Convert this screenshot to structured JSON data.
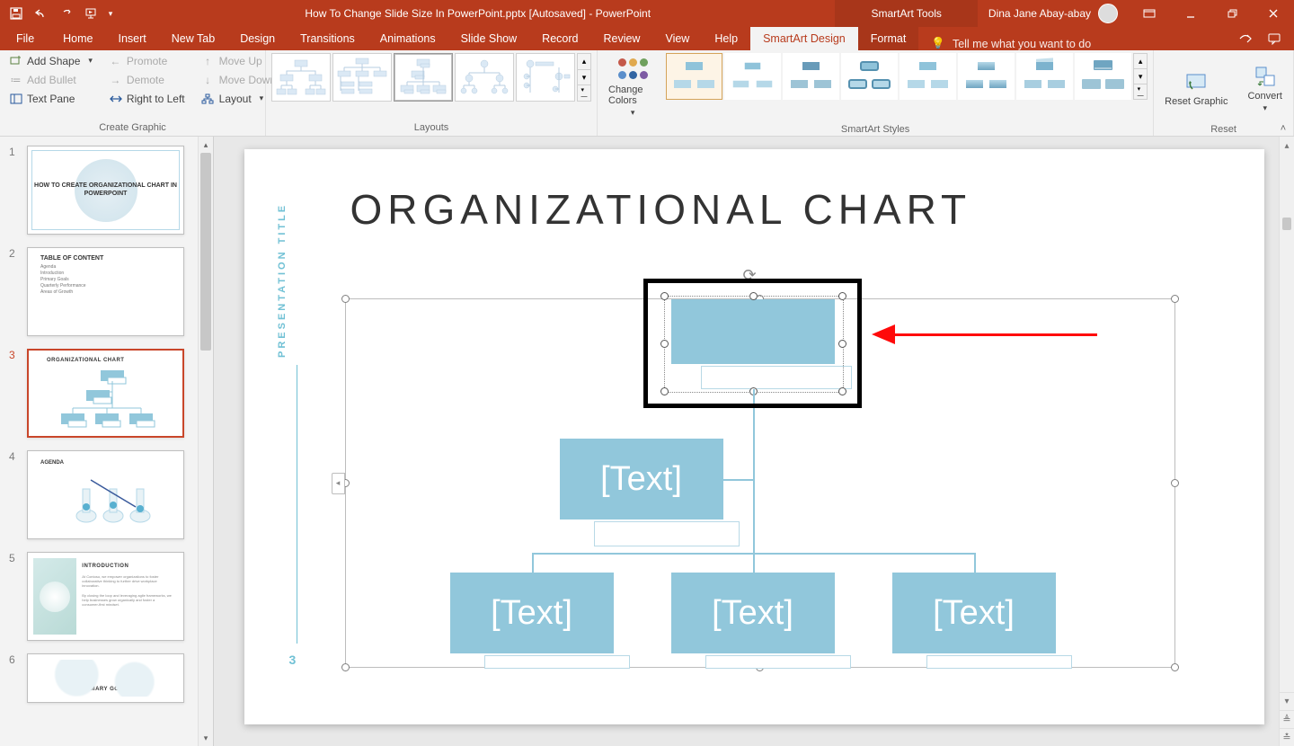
{
  "titlebar": {
    "doc_title": "How To Change Slide Size In PowerPoint.pptx [Autosaved]  -  PowerPoint",
    "context_tool": "SmartArt Tools",
    "user_name": "Dina Jane Abay-abay"
  },
  "tabs": {
    "file": "File",
    "home": "Home",
    "insert": "Insert",
    "newtab": "New Tab",
    "design": "Design",
    "transitions": "Transitions",
    "animations": "Animations",
    "slideshow": "Slide Show",
    "record": "Record",
    "review": "Review",
    "view": "View",
    "help": "Help",
    "smartart_design": "SmartArt Design",
    "format": "Format",
    "tellme": "Tell me what you want to do"
  },
  "ribbon": {
    "create_graphic": {
      "add_shape": "Add Shape",
      "add_bullet": "Add Bullet",
      "text_pane": "Text Pane",
      "promote": "Promote",
      "demote": "Demote",
      "right_to_left": "Right to Left",
      "move_up": "Move Up",
      "move_down": "Move Down",
      "layout": "Layout",
      "group_label": "Create Graphic"
    },
    "layouts": {
      "group_label": "Layouts"
    },
    "change_colors": "Change Colors",
    "styles": {
      "group_label": "SmartArt Styles"
    },
    "reset": {
      "reset_graphic": "Reset Graphic",
      "convert": "Convert",
      "group_label": "Reset"
    }
  },
  "thumbnails": [
    {
      "num": "1",
      "title": "HOW TO CREATE ORGANIZATIONAL CHART IN POWERPOINT"
    },
    {
      "num": "2",
      "title": "TABLE OF CONTENT",
      "items": [
        "Agenda",
        "Introduction",
        "Primary Goals",
        "Quarterly Performance",
        "Areas of Growth"
      ]
    },
    {
      "num": "3",
      "title": "ORGANIZATIONAL CHART"
    },
    {
      "num": "4",
      "title": "AGENDA"
    },
    {
      "num": "5",
      "title": "INTRODUCTION"
    },
    {
      "num": "6",
      "title": "PRIMARY GOALS"
    }
  ],
  "slide": {
    "side_title": "PRESENTATION TITLE",
    "number": "3",
    "heading": "ORGANIZATIONAL CHART",
    "node_placeholder": "[Text]"
  }
}
